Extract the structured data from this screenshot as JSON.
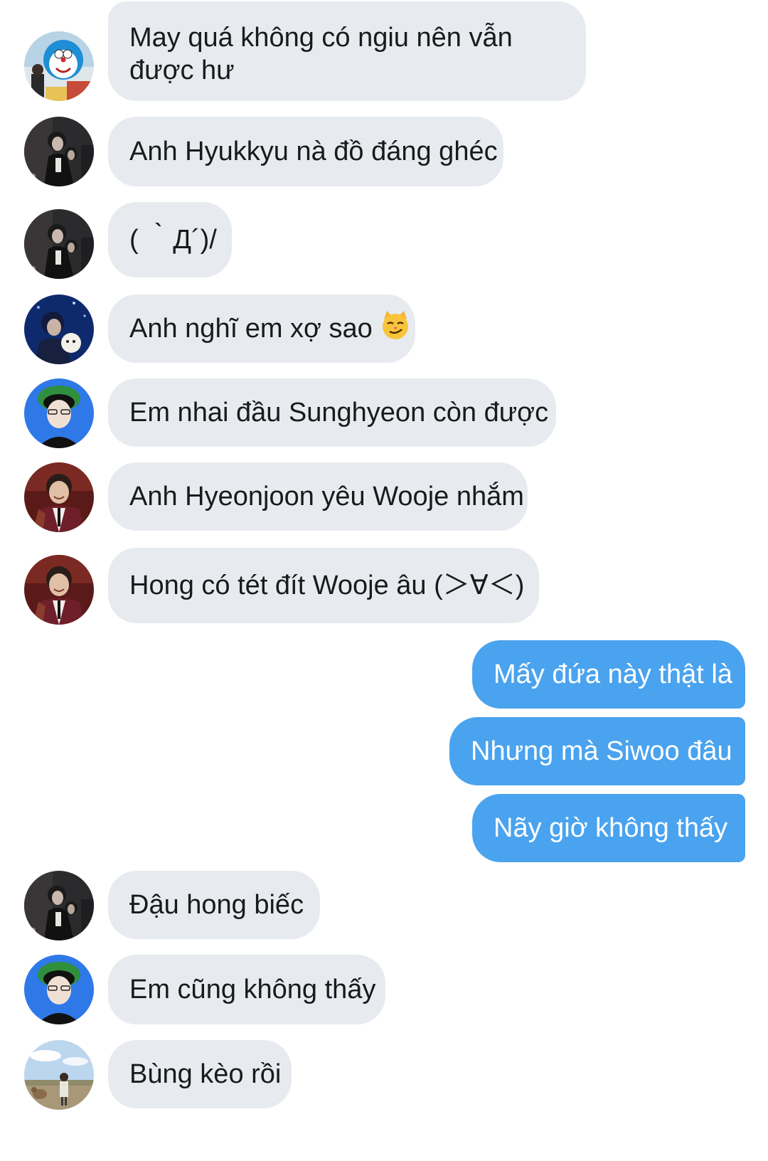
{
  "colors": {
    "incoming_bubble": "#e7ebf0",
    "outgoing_bubble": "#4aa3ee",
    "incoming_text": "#1a1a1a",
    "outgoing_text": "#ffffff"
  },
  "messages": [
    {
      "direction": "incoming",
      "avatar": "avatar-doraemon-photo",
      "text": "May quá không có ngiu nên vẫn được hư"
    },
    {
      "direction": "incoming",
      "avatar": "avatar-dark-photo",
      "text": "Anh Hyukkyu nà đồ đáng ghéc"
    },
    {
      "direction": "incoming",
      "avatar": "avatar-dark-photo",
      "text": "( ｀Д´)/"
    },
    {
      "direction": "incoming",
      "avatar": "avatar-blue-night-photo",
      "text": "Anh nghĩ em xợ sao",
      "emoji": "smirking-cat-emoji"
    },
    {
      "direction": "incoming",
      "avatar": "avatar-blue-green-cap-photo",
      "text": "Em nhai đầu Sunghyeon còn được"
    },
    {
      "direction": "incoming",
      "avatar": "avatar-red-portrait-photo",
      "text": "Anh Hyeonjoon yêu Wooje nhắm"
    },
    {
      "direction": "incoming",
      "avatar": "avatar-red-portrait-photo",
      "text": "Hong có tét đít Wooje âu (＞∀＜)"
    },
    {
      "direction": "outgoing",
      "text": "Mấy đứa này thật là"
    },
    {
      "direction": "outgoing",
      "text": "Nhưng mà Siwoo đâu"
    },
    {
      "direction": "outgoing",
      "text": "Nãy giờ không thấy"
    },
    {
      "direction": "incoming",
      "avatar": "avatar-dark-photo",
      "text": "Đậu hong biếc"
    },
    {
      "direction": "incoming",
      "avatar": "avatar-blue-green-cap-photo",
      "text": "Em cũng không thấy"
    },
    {
      "direction": "incoming",
      "avatar": "avatar-outdoor-field-photo",
      "text": "Bùng kèo rồi"
    }
  ]
}
